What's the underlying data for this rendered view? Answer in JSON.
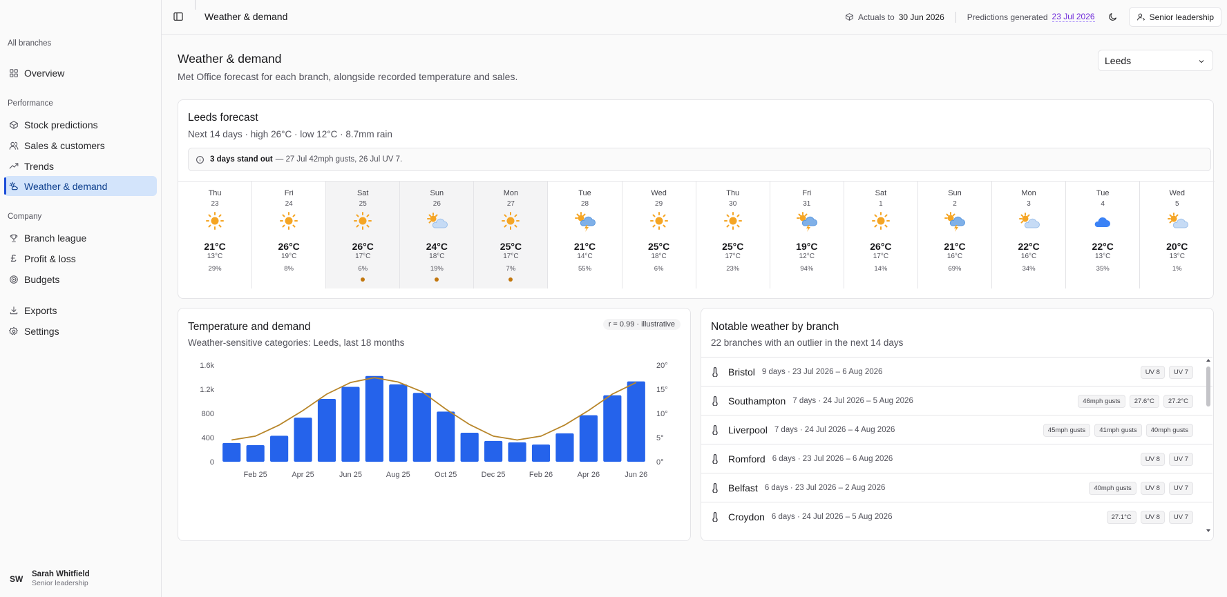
{
  "sidebar": {
    "section_all": "All branches",
    "overview": "Overview",
    "section_performance": "Performance",
    "stock_predictions": "Stock predictions",
    "sales_customers": "Sales & customers",
    "trends": "Trends",
    "weather_demand": "Weather & demand",
    "section_company": "Company",
    "branch_league": "Branch league",
    "profit_loss": "Profit & loss",
    "budgets": "Budgets",
    "exports": "Exports",
    "settings": "Settings",
    "user": {
      "initials": "SW",
      "name": "Sarah Whitfield",
      "role": "Senior leadership"
    }
  },
  "header": {
    "title": "Weather & demand",
    "actuals_label": "Actuals to",
    "actuals_date": "30 Jun 2026",
    "predictions_label": "Predictions generated",
    "predictions_date": "23 Jul 2026",
    "role_button": "Senior leadership"
  },
  "page": {
    "title": "Weather & demand",
    "subtitle": "Met Office forecast for each branch, alongside recorded temperature and sales.",
    "branch_select": "Leeds"
  },
  "forecast": {
    "title": "Leeds forecast",
    "subtitle": "Next 14 days · high 26°C · low 12°C · 8.7mm rain",
    "alert_bold": "3 days stand out",
    "alert_rest": "— 27 Jul 42mph gusts, 26 Jul UV 7.",
    "days": [
      {
        "name": "Thu",
        "date": "23",
        "icon": "sun-icon",
        "high": "21°C",
        "low": "13°C",
        "precip": "29%",
        "highlight": false
      },
      {
        "name": "Fri",
        "date": "24",
        "icon": "sun-icon",
        "high": "26°C",
        "low": "19°C",
        "precip": "8%",
        "highlight": false
      },
      {
        "name": "Sat",
        "date": "25",
        "icon": "sun-icon",
        "high": "26°C",
        "low": "17°C",
        "precip": "6%",
        "highlight": true
      },
      {
        "name": "Sun",
        "date": "26",
        "icon": "partly-cloudy-icon",
        "high": "24°C",
        "low": "18°C",
        "precip": "19%",
        "highlight": true
      },
      {
        "name": "Mon",
        "date": "27",
        "icon": "sun-icon",
        "high": "25°C",
        "low": "17°C",
        "precip": "7%",
        "highlight": true
      },
      {
        "name": "Tue",
        "date": "28",
        "icon": "thunderstorm-icon",
        "high": "21°C",
        "low": "14°C",
        "precip": "55%",
        "highlight": false
      },
      {
        "name": "Wed",
        "date": "29",
        "icon": "sun-icon",
        "high": "25°C",
        "low": "18°C",
        "precip": "6%",
        "highlight": false
      },
      {
        "name": "Thu",
        "date": "30",
        "icon": "sun-icon",
        "high": "25°C",
        "low": "17°C",
        "precip": "23%",
        "highlight": false
      },
      {
        "name": "Fri",
        "date": "31",
        "icon": "thunderstorm-icon",
        "high": "19°C",
        "low": "12°C",
        "precip": "94%",
        "highlight": false
      },
      {
        "name": "Sat",
        "date": "1",
        "icon": "sun-icon",
        "high": "26°C",
        "low": "17°C",
        "precip": "14%",
        "highlight": false
      },
      {
        "name": "Sun",
        "date": "2",
        "icon": "thunderstorm-icon",
        "high": "21°C",
        "low": "16°C",
        "precip": "69%",
        "highlight": false
      },
      {
        "name": "Mon",
        "date": "3",
        "icon": "partly-cloudy-icon",
        "high": "22°C",
        "low": "16°C",
        "precip": "34%",
        "highlight": false
      },
      {
        "name": "Tue",
        "date": "4",
        "icon": "cloudy-night-icon",
        "high": "22°C",
        "low": "13°C",
        "precip": "35%",
        "highlight": false
      },
      {
        "name": "Wed",
        "date": "5",
        "icon": "partly-cloudy-icon",
        "high": "20°C",
        "low": "13°C",
        "precip": "1%",
        "highlight": false
      }
    ]
  },
  "temp_demand": {
    "title": "Temperature and demand",
    "subtitle": "Weather-sensitive categories: Leeds, last 18 months",
    "badge": "r = 0.99 · illustrative"
  },
  "chart_data": {
    "type": "bar",
    "categories": [
      "Jan 25",
      "Feb 25",
      "Mar 25",
      "Apr 25",
      "May 25",
      "Jun 25",
      "Jul 25",
      "Aug 25",
      "Sep 25",
      "Oct 25",
      "Nov 25",
      "Dec 25",
      "Jan 26",
      "Feb 26",
      "Mar 26",
      "Apr 26",
      "May 26",
      "Jun 26"
    ],
    "x_tick_labels": [
      "Feb 25",
      "Apr 25",
      "Jun 25",
      "Aug 25",
      "Oct 25",
      "Dec 25",
      "Feb 26",
      "Apr 26",
      "Jun 26"
    ],
    "y_ticks": [
      "0",
      "400",
      "800",
      "1.2k",
      "1.6k"
    ],
    "y2_ticks": [
      "0°",
      "5°",
      "10°",
      "15°",
      "20°"
    ],
    "ylim": [
      0,
      1600
    ],
    "y2lim": [
      0,
      20
    ],
    "series": [
      {
        "kind": "bar",
        "color": "#2563eb",
        "values": [
          310,
          275,
          430,
          730,
          1040,
          1240,
          1420,
          1280,
          1140,
          830,
          480,
          345,
          320,
          285,
          470,
          770,
          1100,
          1330
        ]
      },
      {
        "kind": "line",
        "color": "#b8862a",
        "values": [
          4.5,
          5.3,
          7.6,
          10.6,
          14.0,
          16.4,
          17.4,
          16.5,
          14.5,
          10.9,
          7.7,
          5.3,
          4.5,
          5.3,
          7.6,
          10.6,
          14.0,
          16.4
        ]
      }
    ]
  },
  "notable": {
    "title": "Notable weather by branch",
    "subtitle": "22 branches with an outlier in the next 14 days",
    "rows": [
      {
        "name": "Bristol",
        "meta": "9 days · 23 Jul 2026 – 6 Aug 2026",
        "tags": [
          "UV 8",
          "UV 7"
        ]
      },
      {
        "name": "Southampton",
        "meta": "7 days · 24 Jul 2026 – 5 Aug 2026",
        "tags": [
          "46mph gusts",
          "27.6°C",
          "27.2°C"
        ]
      },
      {
        "name": "Liverpool",
        "meta": "7 days · 24 Jul 2026 – 4 Aug 2026",
        "tags": [
          "45mph gusts",
          "41mph gusts",
          "40mph gusts"
        ]
      },
      {
        "name": "Romford",
        "meta": "6 days · 23 Jul 2026 – 6 Aug 2026",
        "tags": [
          "UV 8",
          "UV 7"
        ]
      },
      {
        "name": "Belfast",
        "meta": "6 days · 23 Jul 2026 – 2 Aug 2026",
        "tags": [
          "40mph gusts",
          "UV 8",
          "UV 7"
        ]
      },
      {
        "name": "Croydon",
        "meta": "6 days · 24 Jul 2026 – 5 Aug 2026",
        "tags": [
          "27.1°C",
          "UV 8",
          "UV 7"
        ]
      }
    ]
  }
}
